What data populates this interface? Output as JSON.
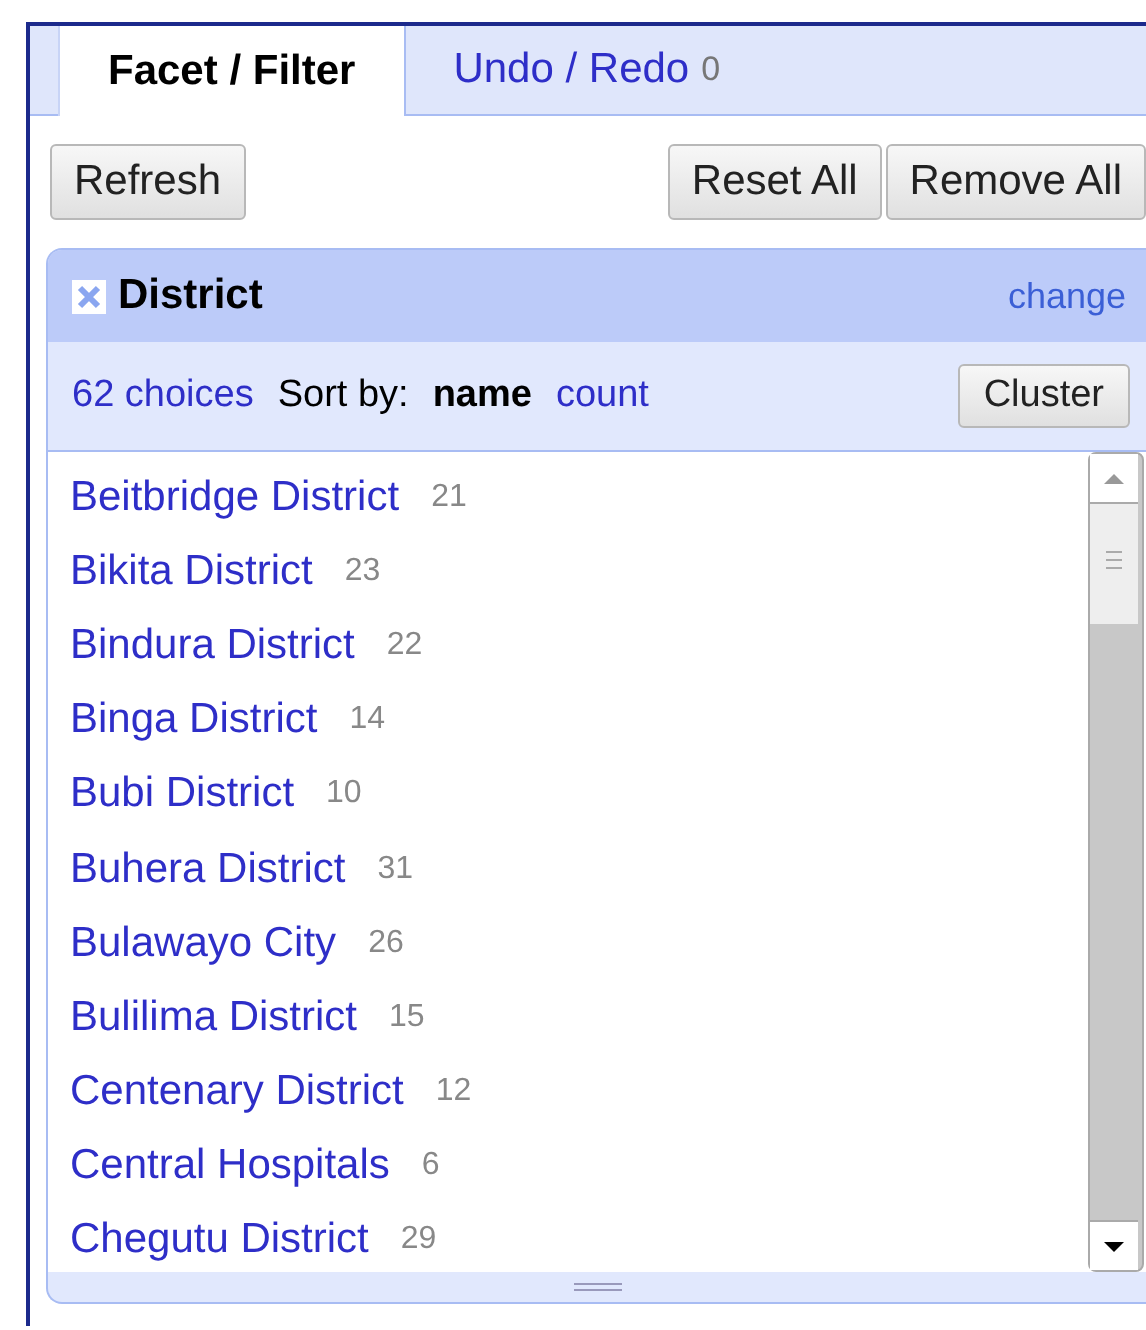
{
  "tabs": [
    {
      "label": "Facet / Filter",
      "selected": true
    },
    {
      "label": "Undo / Redo",
      "count": "0",
      "selected": false
    }
  ],
  "toolbar": {
    "left_buttons": [
      "Refresh"
    ],
    "right_buttons": [
      "Reset All",
      "Remove All"
    ]
  },
  "facet": {
    "title": "District",
    "change_link": "change",
    "choices": "62 choices",
    "sort_label": "Sort by:",
    "sort_options": [
      {
        "label": "name",
        "selected": true
      },
      {
        "label": "count",
        "selected": false
      }
    ],
    "cluster_button": "Cluster",
    "items": [
      {
        "name": "Beitbridge District",
        "count": "21"
      },
      {
        "name": "Bikita District",
        "count": "23"
      },
      {
        "name": "Bindura District",
        "count": "22"
      },
      {
        "name": "Binga District",
        "count": "14"
      },
      {
        "name": "Bubi District",
        "count": "10"
      },
      {
        "name": "Buhera District",
        "count": "31"
      },
      {
        "name": "Bulawayo City",
        "count": "26"
      },
      {
        "name": "Bulilima District",
        "count": "15"
      },
      {
        "name": "Centenary District",
        "count": "12"
      },
      {
        "name": "Central Hospitals",
        "count": "6"
      },
      {
        "name": "Chegutu District",
        "count": "29"
      }
    ]
  }
}
